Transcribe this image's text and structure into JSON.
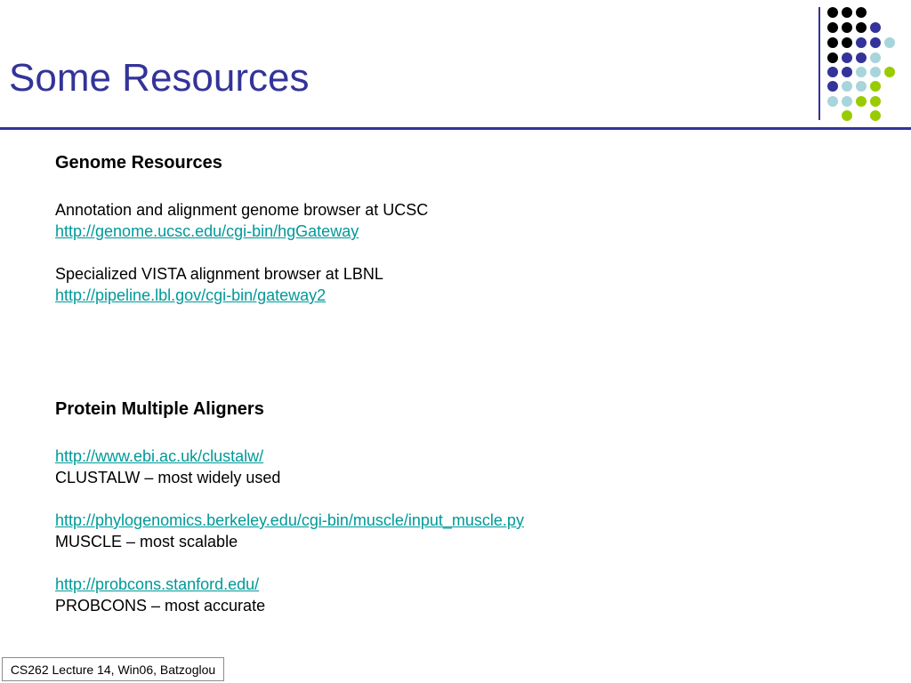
{
  "slide": {
    "title": "Some Resources",
    "colors": {
      "title": "#333399",
      "rule": "#333399",
      "link": "#009999",
      "dot_black": "#000000",
      "dot_navy": "#333399",
      "dot_lightblue": "#a8d4dc",
      "dot_green": "#99cc00"
    }
  },
  "genome": {
    "heading": "Genome Resources",
    "ucsc_desc": "Annotation and alignment genome browser at UCSC",
    "ucsc_link": "http://genome.ucsc.edu/cgi-bin/hgGateway",
    "vista_desc": "Specialized VISTA alignment browser at LBNL",
    "vista_link": "http://pipeline.lbl.gov/cgi-bin/gateway2"
  },
  "protein": {
    "heading": "Protein Multiple Aligners",
    "clustalw_link": "http://www.ebi.ac.uk/clustalw/",
    "clustalw_desc": "CLUSTALW – most widely used",
    "muscle_link": "http://phylogenomics.berkeley.edu/cgi-bin/muscle/input_muscle.py",
    "muscle_desc": "MUSCLE – most scalable",
    "probcons_link": "http://probcons.stanford.edu/",
    "probcons_desc": "PROBCONS – most accurate"
  },
  "footer": {
    "text": "CS262 Lecture 14, Win06, Batzoglou"
  }
}
